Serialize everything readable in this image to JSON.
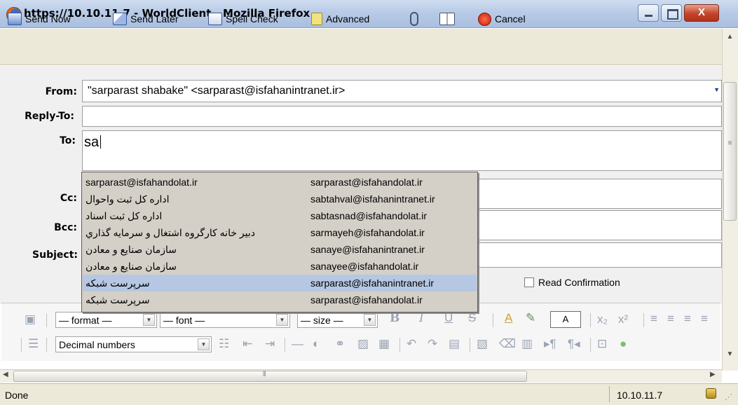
{
  "window": {
    "title": "https://10.10.11.7 - WorldClient - Mozilla Firefox",
    "close_glyph": "X"
  },
  "toolbar": {
    "send_now": "Send Now",
    "send_later": "Send Later",
    "spell_check": "Spell Check",
    "advanced": "Advanced",
    "cancel": "Cancel"
  },
  "form": {
    "from_label": "From:",
    "from_value": "\"sarparast shabake\" <sarparast@isfahanintranet.ir>",
    "replyto_label": "Reply-To:",
    "to_label": "To:",
    "to_value": "sa",
    "cc_label": "Cc:",
    "bcc_label": "Bcc:",
    "subject_label": "Subject:",
    "read_confirmation": "Read Confirmation"
  },
  "autocomplete": {
    "selected_index": 6,
    "items": [
      {
        "name": "sarparast@isfahandolat.ir",
        "email": "sarparast@isfahandolat.ir"
      },
      {
        "name": "اداره کل ثبت واحوال",
        "email": "sabtahval@isfahanintranet.ir"
      },
      {
        "name": "اداره کل ثبت اسناد",
        "email": "sabtasnad@isfahandolat.ir"
      },
      {
        "name": "دبير خانه کارگروه اشتغال و سرمايه گذاري",
        "email": "sarmayeh@isfahandolat.ir"
      },
      {
        "name": "سازمان صنايع و معادن",
        "email": "sanaye@isfahanintranet.ir"
      },
      {
        "name": "سازمان صنايع و معادن",
        "email": "sanayee@isfahandolat.ir"
      },
      {
        "name": "سرپرست شبکه",
        "email": "sarparast@isfahanintranet.ir"
      },
      {
        "name": "سرپرست شبکه",
        "email": "sarparast@isfahandolat.ir"
      }
    ]
  },
  "editor": {
    "format": "— format —",
    "font": "— font —",
    "size": "— size —",
    "list_style": "Decimal numbers",
    "bold": "B",
    "italic": "I",
    "underline": "U",
    "strike": "S",
    "forecolor": "A",
    "box_char": "A"
  },
  "status": {
    "text": "Done",
    "host": "10.10.11.7"
  }
}
